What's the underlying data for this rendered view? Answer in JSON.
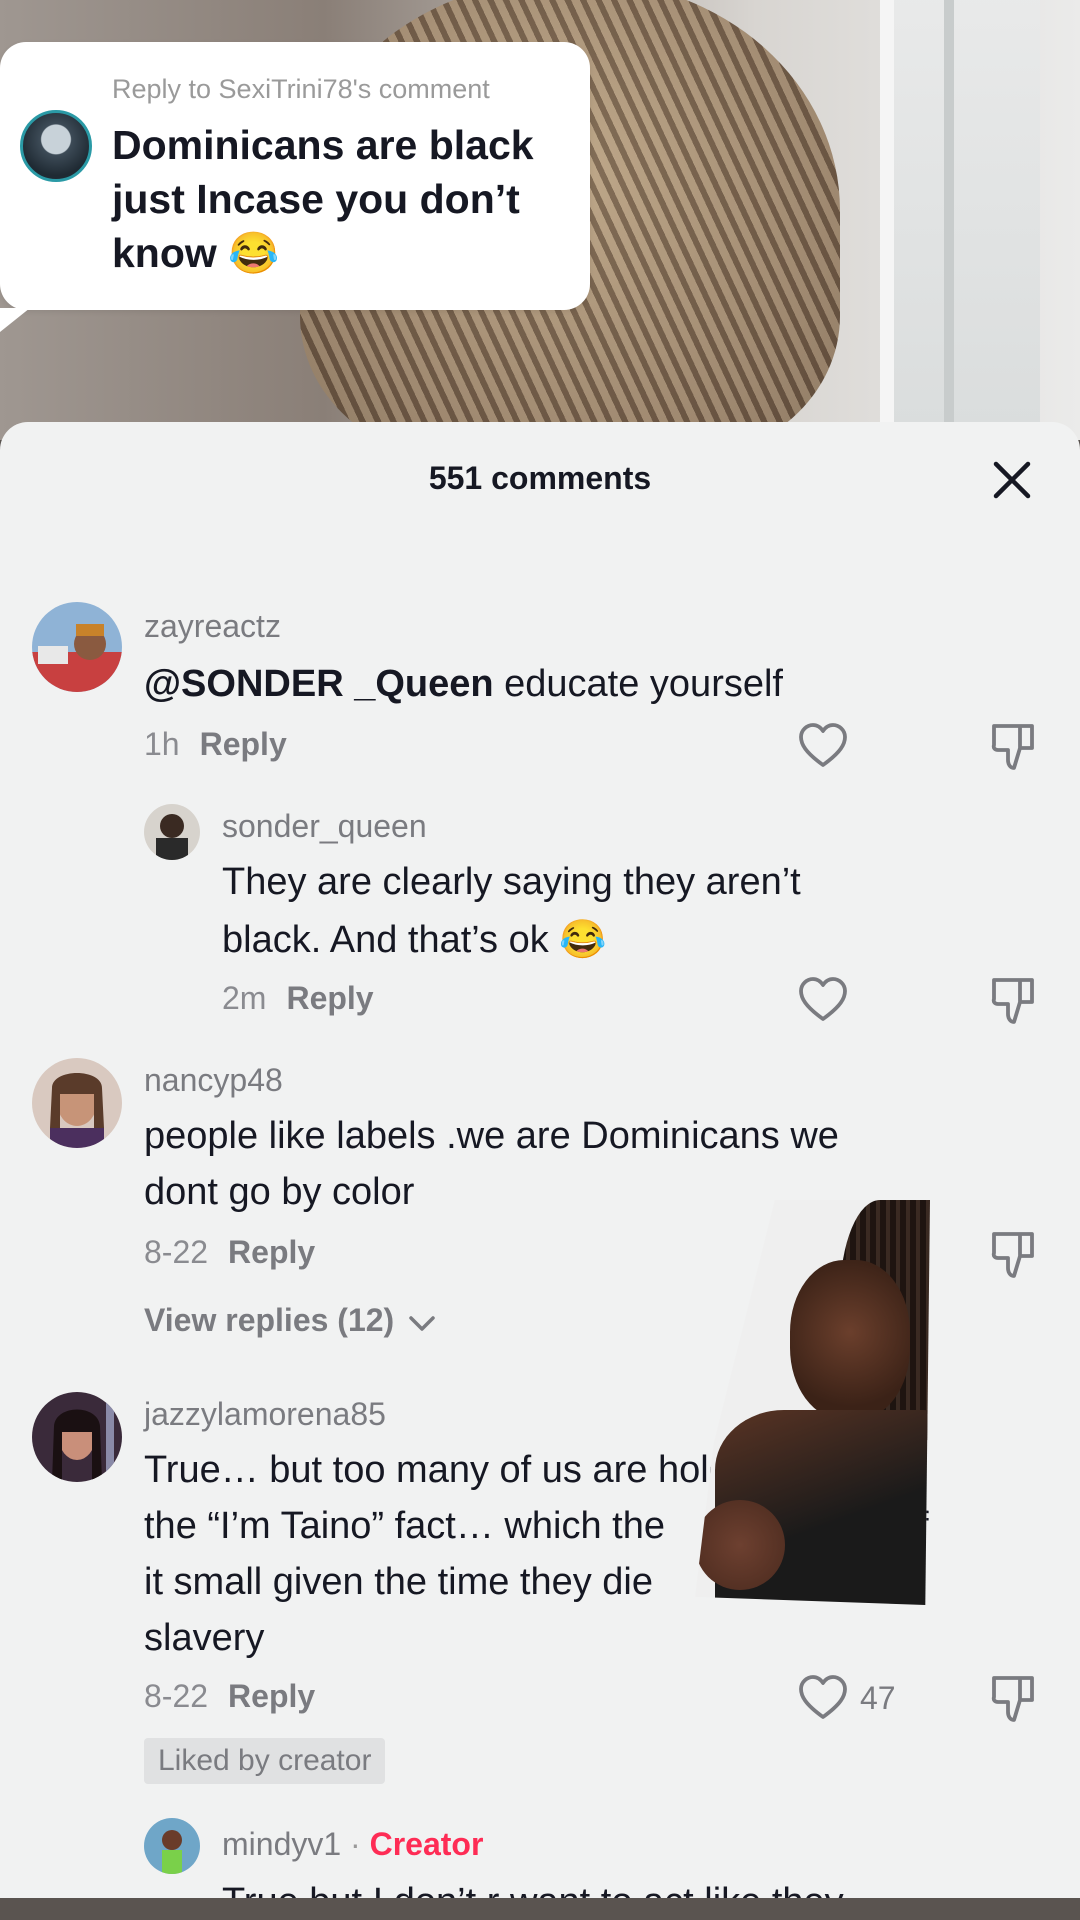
{
  "reply_bubble": {
    "meta": "Reply to SexiTrini78's comment",
    "text": "Dominicans are black just Incase you don’t know 😂"
  },
  "sheet": {
    "title": "551 comments",
    "close_label": "✕"
  },
  "comments": [
    {
      "username": "zayreactz",
      "mention": "@SONDER _Queen",
      "text": "educate yourself",
      "time": "1h",
      "reply": "Reply"
    },
    {
      "username": "sonder_queen",
      "text_line1": "They are clearly saying they aren’t",
      "text_line2": "black. And that’s ok 😂",
      "time": "2m",
      "reply": "Reply"
    },
    {
      "username": "nancyp48",
      "text_line1": "people like labels .we are Dominicans we",
      "text_line2": "dont go by color",
      "time": "8-22",
      "reply": "Reply",
      "view_replies": "View replies (12)"
    },
    {
      "username": "jazzylamorena85",
      "text_line1": "True… but too many of us are holdin",
      "text_line2": "the “I’m Taino” fact… which the",
      "text_line2_tail": "f",
      "text_line3": "it small given the time they die",
      "text_line4": "slavery",
      "time": "8-22",
      "reply": "Reply",
      "likes": "47",
      "badge": "Liked by creator"
    },
    {
      "username": "mindyv1",
      "separator": "·",
      "creator_label": "Creator",
      "text_partial": "True but I don’t r want to act like they"
    }
  ],
  "colors": {
    "accent": "#fe2c55",
    "sheet_bg": "#f1f2f2",
    "text_primary": "#161823",
    "text_secondary": "#7a7b80"
  },
  "icons": [
    "close-icon",
    "heart-icon",
    "dislike-icon",
    "chevron-down-icon"
  ]
}
